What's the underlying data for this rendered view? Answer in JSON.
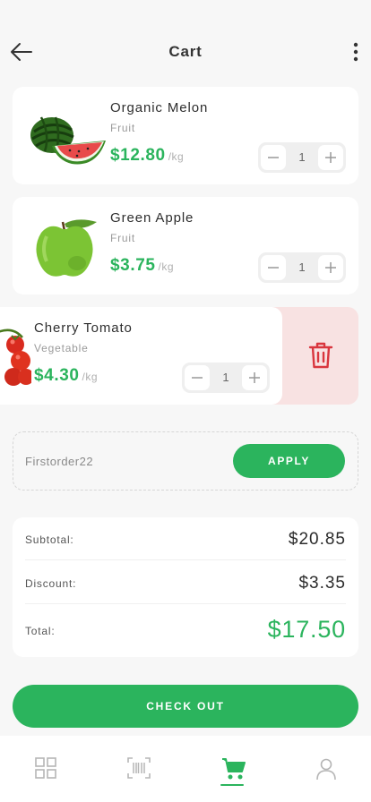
{
  "header": {
    "title": "Cart"
  },
  "cart": {
    "items": [
      {
        "name": "Organic Melon",
        "category": "Fruit",
        "price": "$12.80",
        "unit": "/kg",
        "quantity": "1",
        "image": "watermelon"
      },
      {
        "name": "Green Apple",
        "category": "Fruit",
        "price": "$3.75",
        "unit": "/kg",
        "quantity": "1",
        "image": "green-apple"
      },
      {
        "name": "Cherry Tomato",
        "category": "Vegetable",
        "price": "$4.30",
        "unit": "/kg",
        "quantity": "1",
        "image": "cherry-tomato"
      }
    ],
    "swiped_item_action": "trash-icon"
  },
  "promo": {
    "code": "Firstorder22",
    "apply_label": "APPLY"
  },
  "summary": {
    "subtotal_label": "Subtotal:",
    "subtotal_value": "$20.85",
    "discount_label": "Discount:",
    "discount_value": "$3.35",
    "total_label": "Total:",
    "total_value": "$17.50"
  },
  "checkout": {
    "label": "CHECK OUT"
  },
  "bottom_nav": {
    "items": [
      "grid-icon",
      "barcode-icon",
      "cart-icon",
      "profile-icon"
    ],
    "active": "cart-icon"
  },
  "colors": {
    "accent": "#2bb45d",
    "danger": "#d9363e",
    "danger_bg": "#f8e2e2"
  }
}
